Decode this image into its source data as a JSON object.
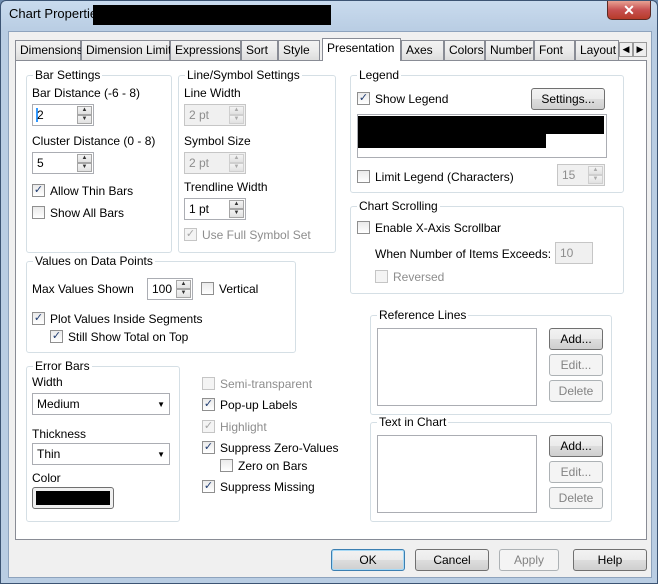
{
  "window": {
    "title": "Chart Properties",
    "close_glyph": "✕"
  },
  "tabs": [
    "Dimensions",
    "Dimension Limits",
    "Expressions",
    "Sort",
    "Style",
    "Presentation",
    "Axes",
    "Colors",
    "Number",
    "Font",
    "Layout"
  ],
  "tab_scroll": {
    "left": "◀",
    "right": "▶"
  },
  "bar_settings": {
    "title": "Bar Settings",
    "bar_distance_label": "Bar Distance (-6 - 8)",
    "bar_distance_value": "2",
    "cluster_distance_label": "Cluster Distance (0 - 8)",
    "cluster_distance_value": "5",
    "allow_thin_bars": "Allow Thin Bars",
    "show_all_bars": "Show All Bars"
  },
  "line_symbol": {
    "title": "Line/Symbol Settings",
    "line_width_label": "Line Width",
    "line_width_value": "2 pt",
    "symbol_size_label": "Symbol Size",
    "symbol_size_value": "2 pt",
    "trendline_width_label": "Trendline Width",
    "trendline_width_value": "1 pt",
    "use_full_symbol_set": "Use Full Symbol Set"
  },
  "legend": {
    "title": "Legend",
    "show_legend": "Show Legend",
    "settings_button": "Settings...",
    "limit_legend": "Limit Legend (Characters)",
    "limit_value": "15"
  },
  "chart_scrolling": {
    "title": "Chart Scrolling",
    "enable_scrollbar": "Enable X-Axis Scrollbar",
    "when_exceeds": "When Number of Items Exceeds:",
    "exceeds_value": "10",
    "reversed": "Reversed"
  },
  "values_on_points": {
    "title": "Values on Data Points",
    "max_values_label": "Max Values Shown",
    "max_values_value": "100",
    "vertical": "Vertical",
    "plot_inside": "Plot Values Inside Segments",
    "still_show_total": "Still Show Total on Top"
  },
  "error_bars": {
    "title": "Error Bars",
    "width_label": "Width",
    "width_value": "Medium",
    "thickness_label": "Thickness",
    "thickness_value": "Thin",
    "color_label": "Color",
    "color_value": "#000000"
  },
  "misc": {
    "semi_transparent": "Semi-transparent",
    "popup_labels": "Pop-up Labels",
    "highlight": "Highlight",
    "suppress_zero": "Suppress Zero-Values",
    "zero_on_bars": "Zero on Bars",
    "suppress_missing": "Suppress Missing"
  },
  "reference_lines": {
    "title": "Reference Lines",
    "add": "Add...",
    "edit": "Edit...",
    "delete": "Delete"
  },
  "text_in_chart": {
    "title": "Text in Chart",
    "add": "Add...",
    "edit": "Edit...",
    "delete": "Delete"
  },
  "footer": {
    "ok": "OK",
    "cancel": "Cancel",
    "apply": "Apply",
    "help": "Help"
  },
  "check_glyph": "✓"
}
